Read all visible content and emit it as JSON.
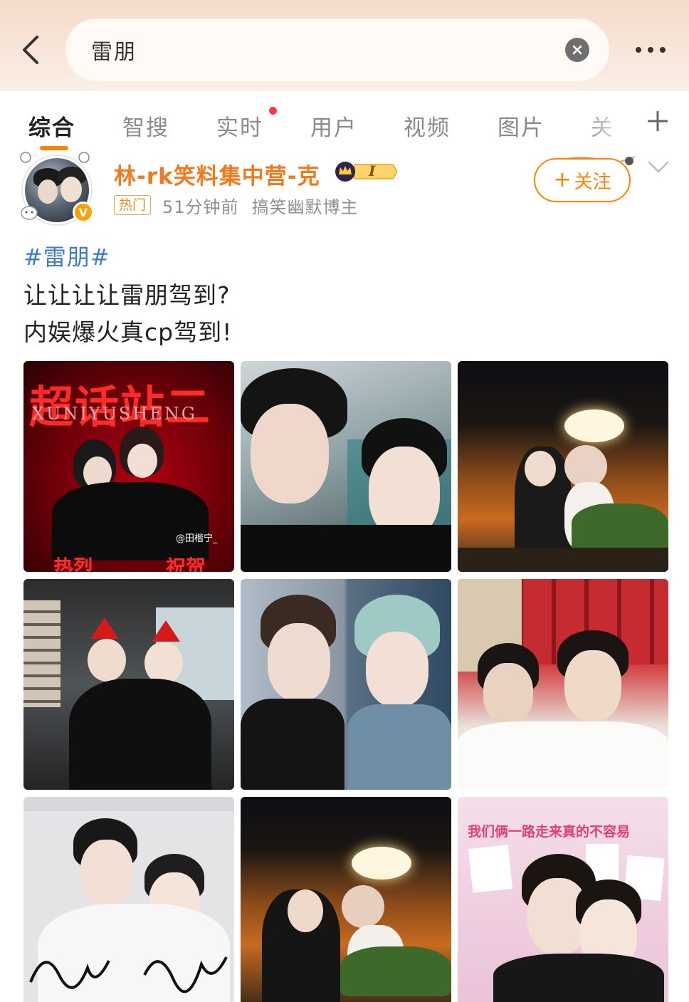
{
  "search": {
    "query": "雷朋"
  },
  "icons": {
    "back": "chevron-left-icon",
    "clear": "close-circle-icon",
    "more": "more-dots-icon",
    "add_tab": "plus-icon",
    "expand": "chevron-down-icon"
  },
  "tabs": [
    {
      "label": "综合",
      "active": true
    },
    {
      "label": "智搜"
    },
    {
      "label": "实时",
      "has_dot": true
    },
    {
      "label": "用户"
    },
    {
      "label": "视频"
    },
    {
      "label": "图片"
    },
    {
      "label": "关"
    }
  ],
  "post": {
    "author": {
      "name": "林-rk笑料集中营-克",
      "level_badge": "I",
      "verified": "V"
    },
    "hot_tag": "热门",
    "time": "51分钟前",
    "description": "搞笑幽默博主",
    "follow_label": "关注",
    "follow_plus": "+",
    "hashtag": "#雷朋#",
    "lines": [
      "让让让让雷朋驾到?",
      "内娱爆火真cp驾到!"
    ],
    "images": [
      {
        "id": "img-1",
        "caption_top": "超话站二",
        "watermark": "XUNIYUSHENG",
        "caption_left": "热烈",
        "caption_right": "祝贺",
        "credit": "@田楷宁_"
      },
      {
        "id": "img-2"
      },
      {
        "id": "img-3"
      },
      {
        "id": "img-4"
      },
      {
        "id": "img-5"
      },
      {
        "id": "img-6"
      },
      {
        "id": "img-7"
      },
      {
        "id": "img-8"
      },
      {
        "id": "img-9",
        "caption_top": "我们俩一路走来真的不容易"
      }
    ]
  },
  "colors": {
    "accent": "#ff8200",
    "username": "#f07a1e",
    "hashtag": "#3d7bc4",
    "tab_dot": "#ff3344"
  }
}
